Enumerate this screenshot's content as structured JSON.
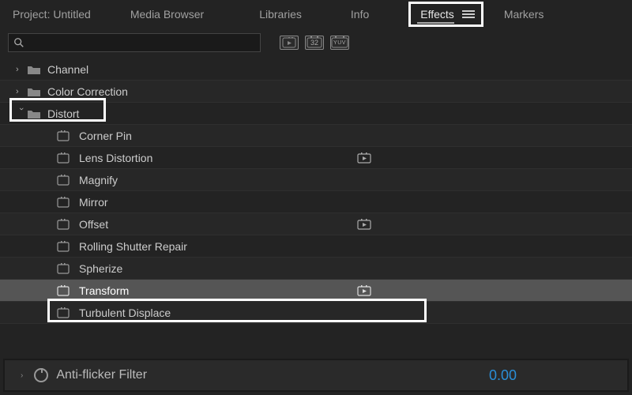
{
  "tabs": {
    "project": "Project: Untitled",
    "media": "Media Browser",
    "libraries": "Libraries",
    "info": "Info",
    "effects": "Effects",
    "markers": "Markers"
  },
  "search": {
    "placeholder": ""
  },
  "badges": {
    "b1": "▸",
    "b2": "32",
    "b3": "YUV"
  },
  "tree": {
    "channel": "Channel",
    "color_correction": "Color Correction",
    "distort": "Distort",
    "children": {
      "corner_pin": "Corner Pin",
      "lens_distortion": "Lens Distortion",
      "magnify": "Magnify",
      "mirror": "Mirror",
      "offset": "Offset",
      "rolling_shutter": "Rolling Shutter Repair",
      "spherize": "Spherize",
      "transform": "Transform",
      "turbulent_displace": "Turbulent Displace"
    }
  },
  "bottom": {
    "label": "Anti-flicker Filter",
    "value": "0.00"
  }
}
